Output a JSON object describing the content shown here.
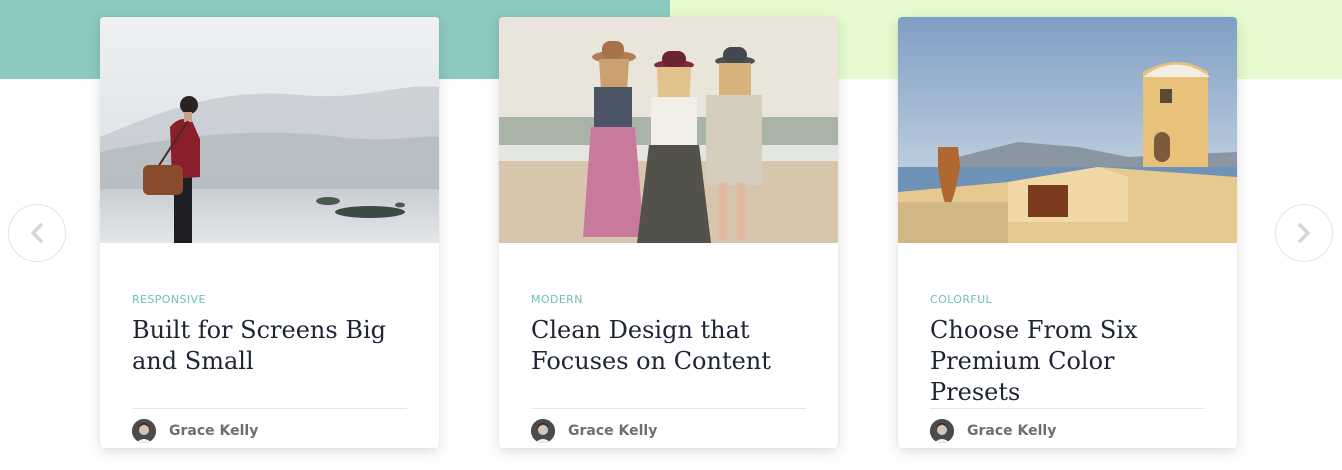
{
  "carousel": {
    "prev_icon": "chevron-left-icon",
    "next_icon": "chevron-right-icon",
    "colors": {
      "band_left": "#8cc9c1",
      "band_right": "#e6fbcf",
      "category": "#6ec0b7",
      "title": "#1e2433",
      "author": "#6b6e74"
    },
    "cards": [
      {
        "category": "RESPONSIVE",
        "title": "Built for Screens Big and Small",
        "author": "Grace Kelly",
        "image": "man-with-bag-by-misty-sea"
      },
      {
        "category": "MODERN",
        "title": "Clean Design that Focuses on Content",
        "author": "Grace Kelly",
        "image": "three-women-in-hats-on-beach"
      },
      {
        "category": "COLORFUL",
        "title": "Choose From Six Premium Color Presets",
        "author": "Grace Kelly",
        "image": "mediterranean-rooftop-with-pot"
      }
    ]
  }
}
